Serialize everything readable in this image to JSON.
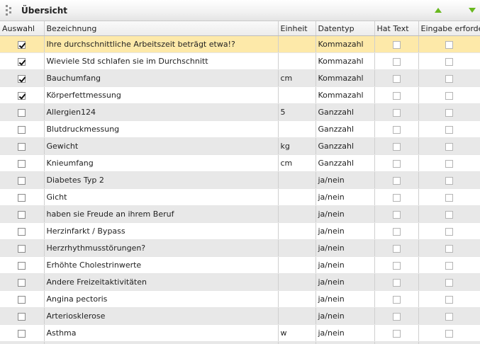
{
  "panel": {
    "title": "Übersicht"
  },
  "columns": [
    "Auswahl",
    "Bezeichnung",
    "Einheit",
    "Datentyp",
    "Hat Text",
    "Eingabe erforderlich"
  ],
  "rows": [
    {
      "selected": true,
      "name": "Ihre durchschnittliche Arbeitszeit beträgt etwa!?",
      "unit": "",
      "type": "Kommazahl"
    },
    {
      "selected": true,
      "name": "Wieviele Std schlafen sie im Durchschnitt",
      "unit": "",
      "type": "Kommazahl"
    },
    {
      "selected": true,
      "name": "Bauchumfang",
      "unit": "cm",
      "type": "Kommazahl"
    },
    {
      "selected": true,
      "name": "Körperfettmessung",
      "unit": "",
      "type": "Kommazahl"
    },
    {
      "selected": false,
      "name": "Allergien124",
      "unit": "5",
      "type": "Ganzzahl"
    },
    {
      "selected": false,
      "name": "Blutdruckmessung",
      "unit": "",
      "type": "Ganzzahl"
    },
    {
      "selected": false,
      "name": "Gewicht",
      "unit": "kg",
      "type": "Ganzzahl"
    },
    {
      "selected": false,
      "name": "Knieumfang",
      "unit": "cm",
      "type": "Ganzzahl"
    },
    {
      "selected": false,
      "name": "Diabetes Typ 2",
      "unit": "",
      "type": "ja/nein"
    },
    {
      "selected": false,
      "name": "Gicht",
      "unit": "",
      "type": "ja/nein"
    },
    {
      "selected": false,
      "name": "haben sie Freude an ihrem Beruf",
      "unit": "",
      "type": "ja/nein"
    },
    {
      "selected": false,
      "name": "Herzinfarkt / Bypass",
      "unit": "",
      "type": "ja/nein"
    },
    {
      "selected": false,
      "name": "Herzrhythmusstörungen?",
      "unit": "",
      "type": "ja/nein"
    },
    {
      "selected": false,
      "name": "Erhöhte Cholestrinwerte",
      "unit": "",
      "type": "ja/nein"
    },
    {
      "selected": false,
      "name": "Andere Freizeitaktivitäten",
      "unit": "",
      "type": "ja/nein"
    },
    {
      "selected": false,
      "name": "Angina pectoris",
      "unit": "",
      "type": "ja/nein"
    },
    {
      "selected": false,
      "name": "Arteriosklerose",
      "unit": "",
      "type": "ja/nein"
    },
    {
      "selected": false,
      "name": "Asthma",
      "unit": "w",
      "type": "ja/nein"
    },
    {
      "selected": false,
      "name": "",
      "unit": "",
      "type": ""
    }
  ]
}
